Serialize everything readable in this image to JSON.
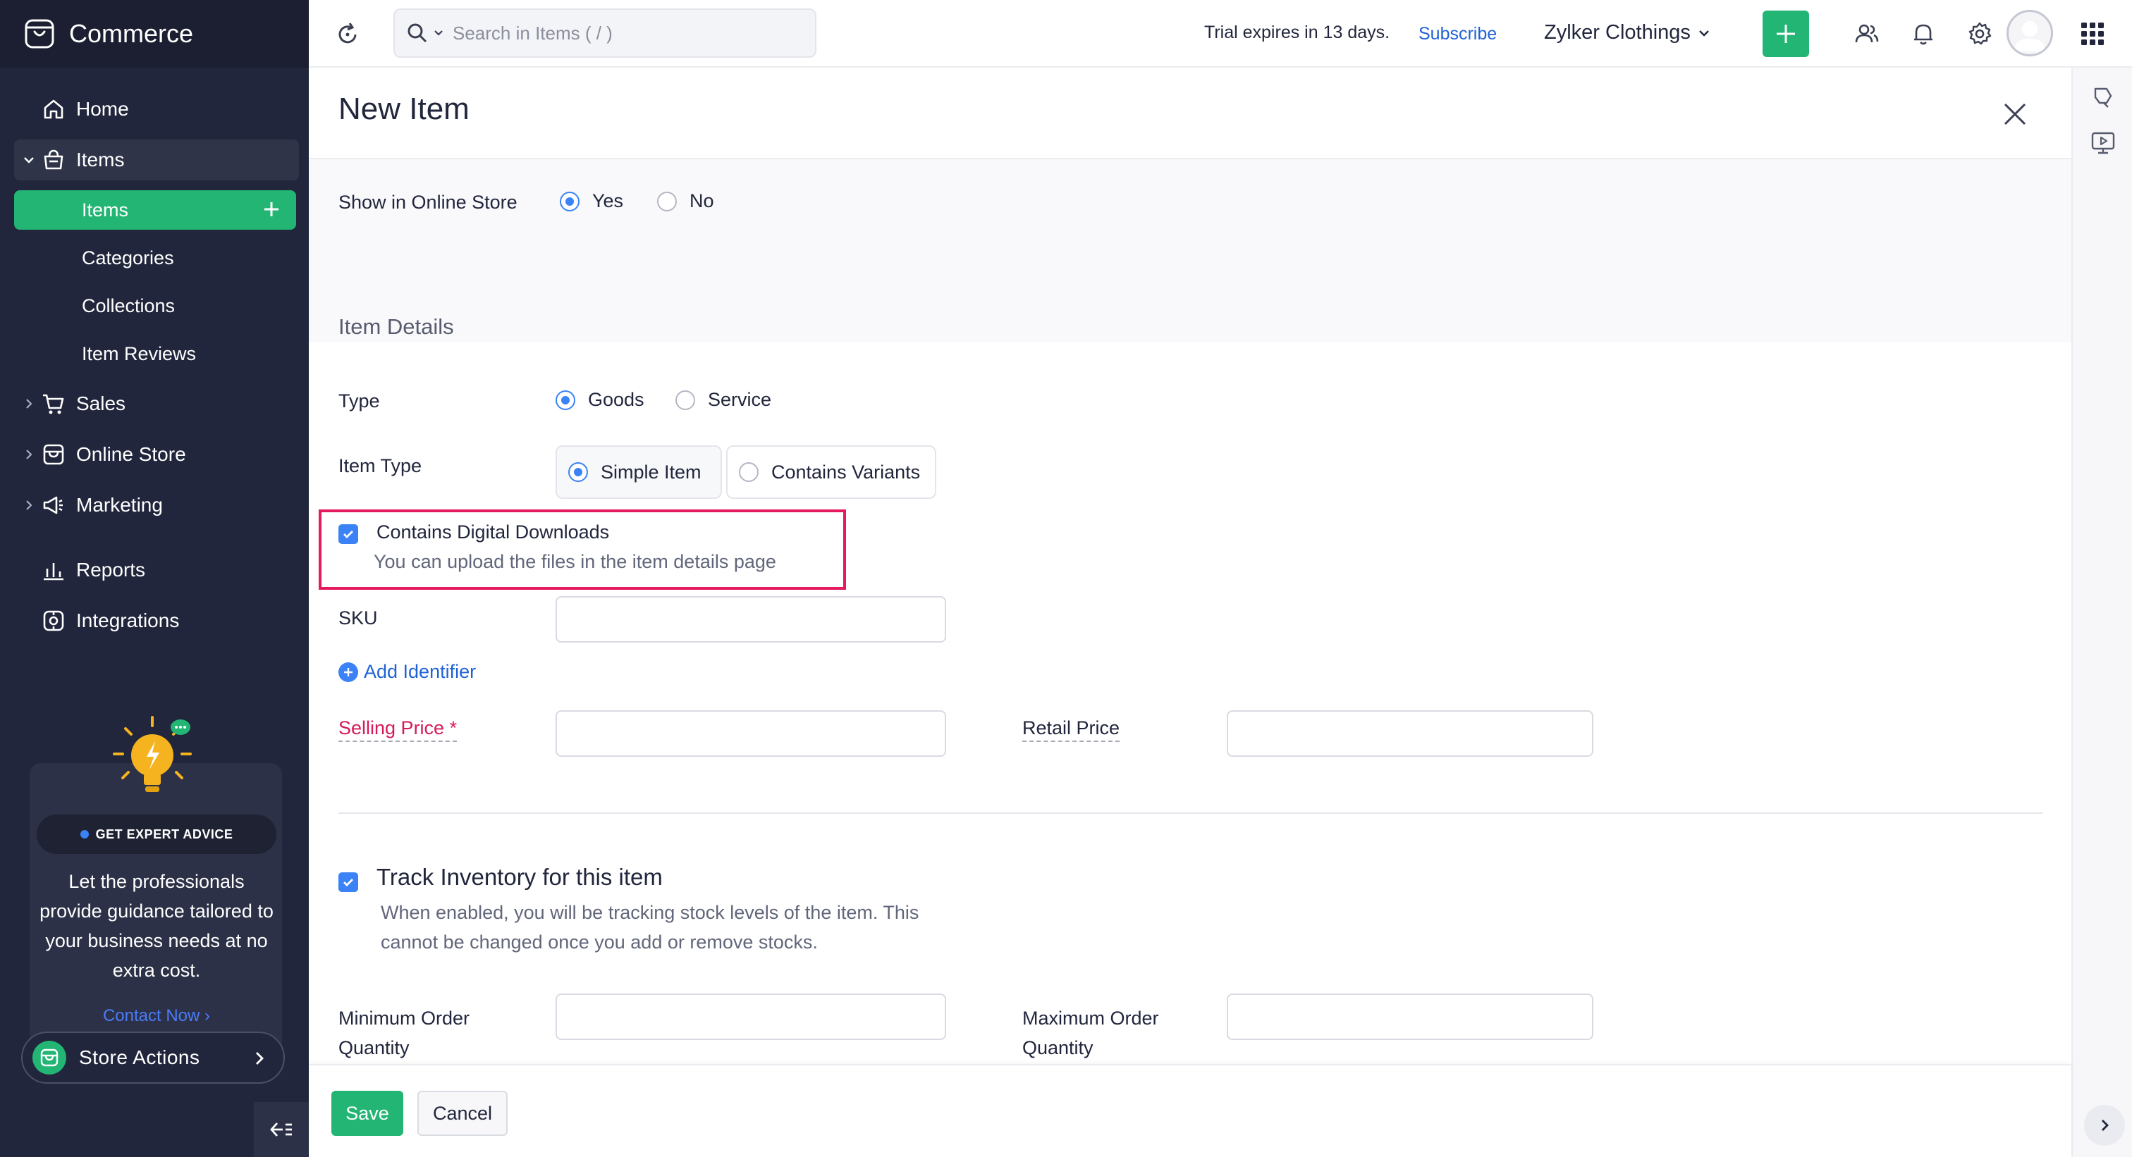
{
  "app": {
    "brand": "Commerce",
    "icons": {
      "brand": "shopping-bag-icon"
    }
  },
  "sidebar": {
    "home": "Home",
    "items_group": "Items",
    "items_sub": [
      "Items",
      "Categories",
      "Collections",
      "Item Reviews"
    ],
    "sales": "Sales",
    "online_store": "Online Store",
    "marketing": "Marketing",
    "reports": "Reports",
    "integrations": "Integrations",
    "advice_pill": "GET EXPERT ADVICE",
    "advice_text": "Let the professionals provide guidance tailored to your business needs at no extra cost.",
    "contact_link": "Contact Now ›",
    "store_actions": "Store Actions"
  },
  "header": {
    "search_placeholder": "Search in Items ( / )",
    "trial": "Trial expires in 13 days.",
    "subscribe": "Subscribe",
    "org": "Zylker Clothings"
  },
  "page": {
    "title": "New Item",
    "show_online_label": "Show in Online Store",
    "show_online_options": [
      "Yes",
      "No"
    ],
    "show_online_selected": "Yes",
    "section_title": "Item Details",
    "type_label": "Type",
    "type_options": [
      "Goods",
      "Service"
    ],
    "type_selected": "Goods",
    "item_type_label": "Item Type",
    "item_type_options": [
      "Simple Item",
      "Contains Variants"
    ],
    "item_type_selected": "Simple Item",
    "digital_title": "Contains Digital Downloads",
    "digital_sub": "You can upload the files in the item details page",
    "digital_checked": true,
    "sku_label": "SKU",
    "sku_value": "",
    "add_identifier": "Add Identifier",
    "selling_price_label": "Selling Price *",
    "selling_price_value": "",
    "retail_price_label": "Retail Price",
    "retail_price_value": "",
    "track_title": "Track Inventory for this item",
    "track_sub_1": "When enabled, you will be tracking stock levels of the item. This",
    "track_sub_2": "cannot be changed once you add or remove stocks.",
    "track_checked": true,
    "min_order_label_1": "Minimum Order",
    "min_order_label_2": "Quantity",
    "max_order_label_1": "Maximum Order",
    "max_order_label_2": "Quantity"
  },
  "footer": {
    "save": "Save",
    "cancel": "Cancel"
  },
  "colors": {
    "sidebar_bg": "#21263c",
    "accent_green": "#22b573",
    "accent_blue": "#3b82f6",
    "link_blue": "#1f62d6",
    "required_red": "#d6195b",
    "highlight_pink": "#e5195e"
  }
}
